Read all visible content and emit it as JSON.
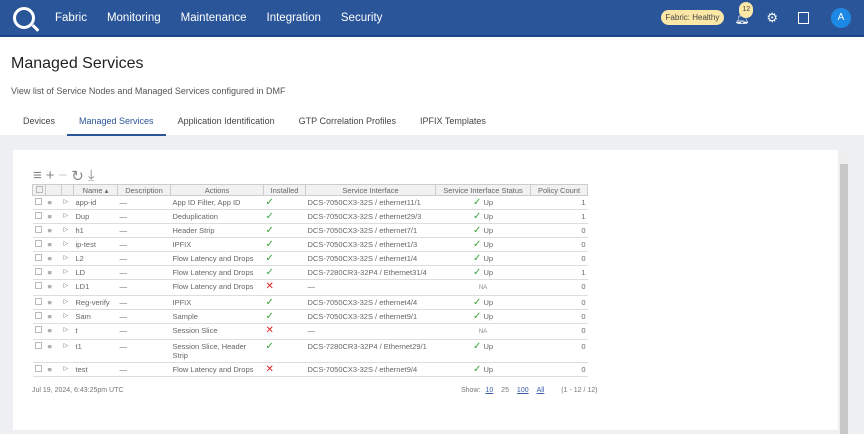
{
  "nav": {
    "items": [
      "Fabric",
      "Monitoring",
      "Maintenance",
      "Integration",
      "Security"
    ],
    "fabric_status": "Fabric: Healthy",
    "notification_count": "12",
    "avatar": "A"
  },
  "page": {
    "title": "Managed Services",
    "subtitle": "View list of Service Nodes and Managed Services configured in DMF"
  },
  "tabs": [
    "Devices",
    "Managed Services",
    "Application Identification",
    "GTP Correlation Profiles",
    "IPFIX Templates"
  ],
  "table": {
    "headers": [
      "Name",
      "Description",
      "Actions",
      "Installed",
      "Service Interface",
      "Service Interface Status",
      "Policy Count"
    ],
    "rows": [
      {
        "name": "app-id",
        "desc": "—",
        "actions": "App ID Filter, App ID",
        "installed": true,
        "iface": "DCS-7050CX3-32S / ethernet11/1",
        "status": "Up",
        "count": "1"
      },
      {
        "name": "Dup",
        "desc": "—",
        "actions": "Deduplication",
        "installed": true,
        "iface": "DCS-7050CX3-32S / ethernet29/3",
        "status": "Up",
        "count": "1"
      },
      {
        "name": "h1",
        "desc": "—",
        "actions": "Header Strip",
        "installed": true,
        "iface": "DCS-7050CX3-32S / ethernet7/1",
        "status": "Up",
        "count": "0"
      },
      {
        "name": "ip-test",
        "desc": "—",
        "actions": "IPFIX",
        "installed": true,
        "iface": "DCS-7050CX3-32S / ethernet1/3",
        "status": "Up",
        "count": "0"
      },
      {
        "name": "L2",
        "desc": "—",
        "actions": "Flow Latency and Drops",
        "installed": true,
        "iface": "DCS-7050CX3-32S / ethernet1/4",
        "status": "Up",
        "count": "0"
      },
      {
        "name": "LD",
        "desc": "—",
        "actions": "Flow Latency and Drops",
        "installed": true,
        "iface": "DCS-7280CR3-32P4 / Ethernet31/4",
        "status": "Up",
        "count": "1"
      },
      {
        "name": "LD1",
        "desc": "—",
        "actions": "Flow Latency and Drops",
        "installed": false,
        "iface": "—",
        "status": "NA",
        "count": "0"
      },
      {
        "name": "Reg-verify",
        "desc": "—",
        "actions": "IPFIX",
        "installed": true,
        "iface": "DCS-7050CX3-32S / ethernet4/4",
        "status": "Up",
        "count": "0"
      },
      {
        "name": "Sam",
        "desc": "—",
        "actions": "Sample",
        "installed": true,
        "iface": "DCS-7050CX3-32S / ethernet9/1",
        "status": "Up",
        "count": "0"
      },
      {
        "name": "t",
        "desc": "—",
        "actions": "Session Slice",
        "installed": false,
        "iface": "—",
        "status": "NA",
        "count": "0"
      },
      {
        "name": "t1",
        "desc": "—",
        "actions": "Session Slice, Header Strip",
        "installed": true,
        "iface": "DCS-7280CR3-32P4 / Ethernet29/1",
        "status": "Up",
        "count": "0"
      },
      {
        "name": "test",
        "desc": "—",
        "actions": "Flow Latency and Drops",
        "installed": false,
        "iface": "DCS-7050CX3-32S / ethernet9/4",
        "status": "Up",
        "count": "0"
      }
    ]
  },
  "footer": {
    "timestamp": "Jul 19, 2024, 6:43:25pm UTC",
    "show_label": "Show:",
    "page_sizes": [
      "10",
      "25",
      "100",
      "All"
    ],
    "range": "(1 - 12 / 12)"
  }
}
